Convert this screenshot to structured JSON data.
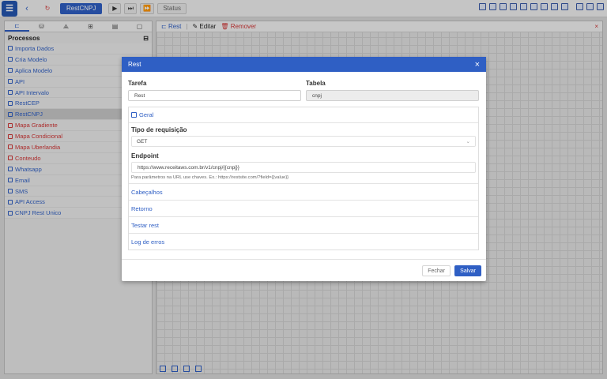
{
  "toolbar": {
    "logo_glyph": "☰",
    "back_glyph": "‹",
    "refresh_glyph": "↻",
    "process_button": "RestCNPJ",
    "play_glyph": "▶",
    "step_glyph": "⏭",
    "fast_glyph": "⏩",
    "status_label": "Status"
  },
  "left": {
    "tabs": [
      "⊏",
      "⛁",
      "⟁",
      "⊞",
      "▤",
      "▢"
    ],
    "header_label": "Processos",
    "add_glyph": "⊟",
    "items": [
      {
        "label": "Importa Dados",
        "color": "blue"
      },
      {
        "label": "Cria Modelo",
        "color": "blue"
      },
      {
        "label": "Aplica Modelo",
        "color": "blue"
      },
      {
        "label": "API",
        "color": "blue"
      },
      {
        "label": "API Intervalo",
        "color": "blue"
      },
      {
        "label": "RestCEP",
        "color": "blue"
      },
      {
        "label": "RestCNPJ",
        "color": "blue",
        "selected": true
      },
      {
        "label": "Mapa Gradiente",
        "color": "red"
      },
      {
        "label": "Mapa Condicional",
        "color": "red"
      },
      {
        "label": "Mapa Uberlandia",
        "color": "red"
      },
      {
        "label": "Conteudo",
        "color": "red"
      },
      {
        "label": "Whatsapp",
        "color": "blue"
      },
      {
        "label": "Email",
        "color": "blue"
      },
      {
        "label": "SMS",
        "color": "blue"
      },
      {
        "label": "API Access",
        "color": "blue"
      },
      {
        "label": "CNPJ Rest Unico",
        "color": "blue"
      }
    ]
  },
  "canvas_toolbar": {
    "rest_label": "Rest",
    "edit_label": "Editar",
    "remove_label": "Remover",
    "close_glyph": "×"
  },
  "modal": {
    "title": "Rest",
    "close_glyph": "×",
    "tarefa_label": "Tarefa",
    "tarefa_value": "Rest",
    "tabela_label": "Tabela",
    "tabela_value": "cnpj",
    "geral_label": "Geral",
    "tipo_label": "Tipo de requisição",
    "tipo_value": "GET",
    "endpoint_label": "Endpoint",
    "endpoint_value": "https://www.receitaws.com.br/v1/cnpj/{{cnpj}}",
    "endpoint_hint": "Para parâmetros na URL use chaves. Ex.: https://restsite.com/?field={{value}}",
    "cabecalhos_label": "Cabeçalhos",
    "retorno_label": "Retorno",
    "testar_label": "Testar rest",
    "log_label": "Log de erros",
    "fechar_label": "Fechar",
    "salvar_label": "Salvar"
  },
  "colors": {
    "accent": "#2f5fc4",
    "danger": "#d13636"
  }
}
